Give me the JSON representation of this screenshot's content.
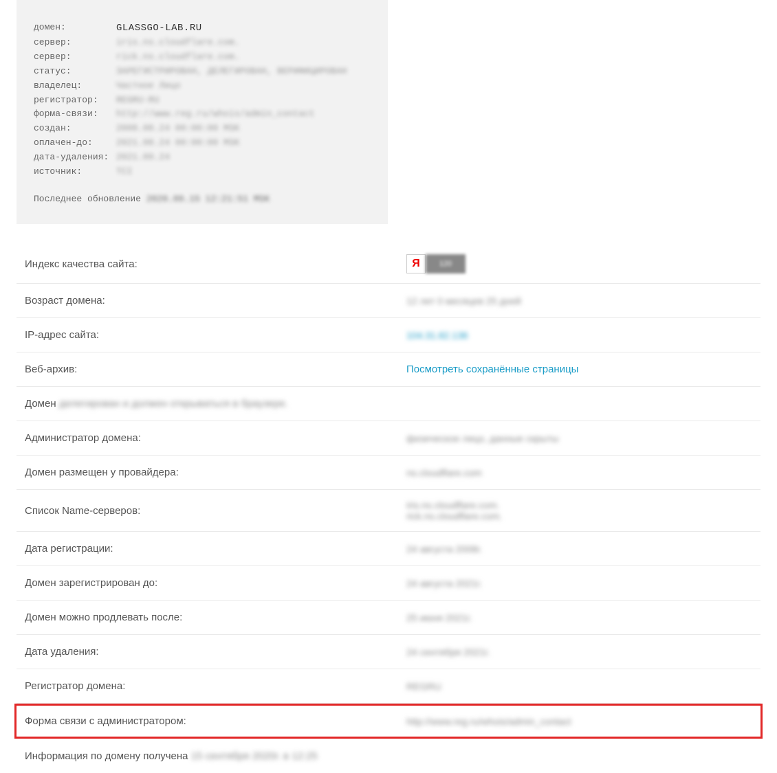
{
  "whois": {
    "rows": [
      {
        "key": "домен:",
        "val": "GLASSGO-LAB.RU",
        "cls": "domain"
      },
      {
        "key": "сервер:",
        "val": "iris.ns.cloudflare.com.",
        "cls": "blur"
      },
      {
        "key": "сервер:",
        "val": "rick.ns.cloudflare.com.",
        "cls": "blur"
      },
      {
        "key": "статус:",
        "val": "ЗАРЕГИСТРИРОВАН, ДЕЛЕГИРОВАН, ВЕРИФИЦИРОВАН",
        "cls": "blur"
      },
      {
        "key": "владелец:",
        "val": "Частное Лицо",
        "cls": "blur"
      },
      {
        "key": "регистратор:",
        "val": "REGRU-RU",
        "cls": "blur"
      },
      {
        "key": "форма-связи:",
        "val": "http://www.reg.ru/whois/admin_contact",
        "cls": "blur"
      },
      {
        "key": "создан:",
        "val": "2008.08.24 00:00:00 MSK",
        "cls": "blur"
      },
      {
        "key": "оплачен-до:",
        "val": "2021.08.24 00:00:00 MSK",
        "cls": "blur"
      },
      {
        "key": "дата-удаления:",
        "val": "2021.09.24",
        "cls": "blur"
      },
      {
        "key": "источник:",
        "val": "TCI",
        "cls": "blur"
      }
    ],
    "footer_prefix": "Последнее обновление ",
    "footer_blur": "2020.09.15 12:21:51 MSK"
  },
  "info": {
    "quality_label": "Индекс качества сайта:",
    "ya_letter": "Я",
    "ya_score": "120",
    "age_label": "Возраст домена:",
    "age_value": "12 лет 0 месяцев 25 дней",
    "ip_label": "IP-адрес сайта:",
    "ip_value": "104.31.82.136",
    "archive_label": "Веб-архив:",
    "archive_value": "Посмотреть сохранённые страницы",
    "delegated_prefix": "Домен ",
    "delegated_blur": "делегирован и должен открываться в браузере.",
    "admin_label": "Администратор домена:",
    "admin_value": "физическое лицо, данные скрыты",
    "provider_label": "Домен размещен у провайдера:",
    "provider_value": "ns.cloudflare.com",
    "ns_label": "Список Name-серверов:",
    "ns_value1": "iris.ns.cloudflare.com.",
    "ns_value2": "rick.ns.cloudflare.com.",
    "regdate_label": "Дата регистрации:",
    "regdate_value": "24 августа 2008г.",
    "reguntil_label": "Домен зарегистрирован до:",
    "reguntil_value": "24 августа 2021г.",
    "renew_label": "Домен можно продлевать после:",
    "renew_value": "25 июня 2021г.",
    "delete_label": "Дата удаления:",
    "delete_value": "24 сентября 2021г.",
    "registrar_label": "Регистратор домена:",
    "registrar_value": "REGRU",
    "contact_label": "Форма связи с администратором:",
    "contact_value": "http://www.reg.ru/whois/admin_contact",
    "obtained_prefix": "Информация по домену получена ",
    "obtained_blur": "15 сентября 2020г. в 12:25"
  }
}
